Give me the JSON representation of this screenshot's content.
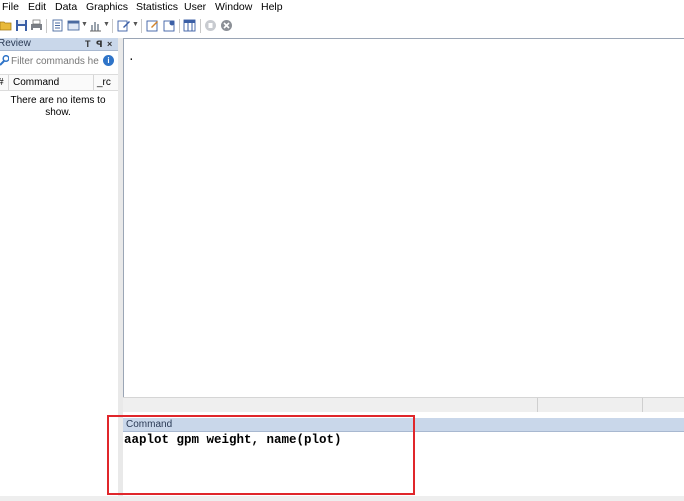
{
  "menu": [
    "File",
    "Edit",
    "Data",
    "Graphics",
    "Statistics",
    "User",
    "Window",
    "Help"
  ],
  "toolbar": {
    "icons": [
      "open-icon",
      "save-icon",
      "print-icon",
      "log-icon",
      "viewer-icon",
      "graph-icon",
      "do-file-editor-icon",
      "data-editor-icon",
      "data-browser-icon",
      "variables-manager-icon",
      "more-icon",
      "break-icon"
    ]
  },
  "review": {
    "title": "Review",
    "pin": "T",
    "float": "ꟼ",
    "close": "×",
    "filter_placeholder": "Filter commands he",
    "col_hash": "#",
    "col_command": "Command",
    "col_rc": "_rc",
    "empty_message": "There are no items to show."
  },
  "results": {
    "prompt": "."
  },
  "command": {
    "title": "Command",
    "text": "aaplot gpm weight, name(plot)"
  },
  "colors": {
    "panel_header": "#c9d7ea",
    "highlight": "#e0262b"
  }
}
